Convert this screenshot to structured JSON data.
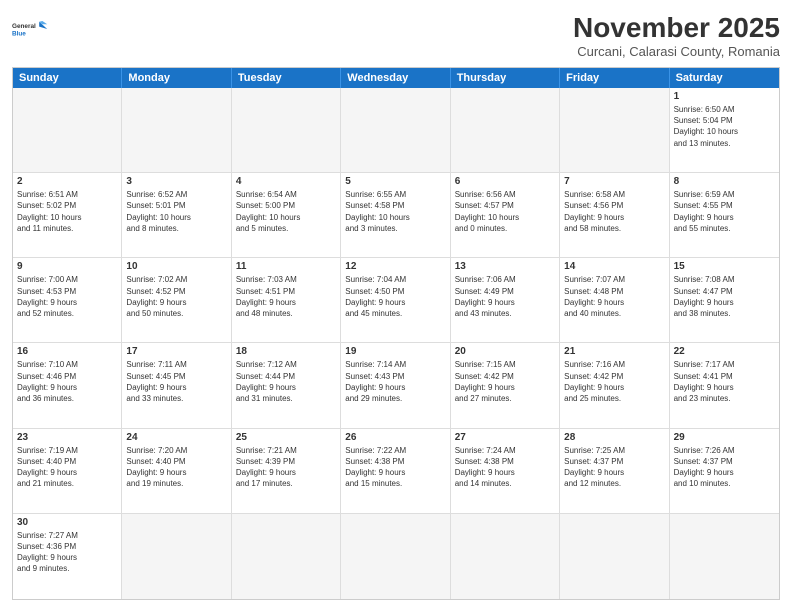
{
  "logo": {
    "text_general": "General",
    "text_blue": "Blue"
  },
  "title": {
    "month_year": "November 2025",
    "location": "Curcani, Calarasi County, Romania"
  },
  "header_days": [
    "Sunday",
    "Monday",
    "Tuesday",
    "Wednesday",
    "Thursday",
    "Friday",
    "Saturday"
  ],
  "weeks": [
    [
      {
        "day": "",
        "info": ""
      },
      {
        "day": "",
        "info": ""
      },
      {
        "day": "",
        "info": ""
      },
      {
        "day": "",
        "info": ""
      },
      {
        "day": "",
        "info": ""
      },
      {
        "day": "",
        "info": ""
      },
      {
        "day": "1",
        "info": "Sunrise: 6:50 AM\nSunset: 5:04 PM\nDaylight: 10 hours\nand 13 minutes."
      }
    ],
    [
      {
        "day": "2",
        "info": "Sunrise: 6:51 AM\nSunset: 5:02 PM\nDaylight: 10 hours\nand 11 minutes."
      },
      {
        "day": "3",
        "info": "Sunrise: 6:52 AM\nSunset: 5:01 PM\nDaylight: 10 hours\nand 8 minutes."
      },
      {
        "day": "4",
        "info": "Sunrise: 6:54 AM\nSunset: 5:00 PM\nDaylight: 10 hours\nand 5 minutes."
      },
      {
        "day": "5",
        "info": "Sunrise: 6:55 AM\nSunset: 4:58 PM\nDaylight: 10 hours\nand 3 minutes."
      },
      {
        "day": "6",
        "info": "Sunrise: 6:56 AM\nSunset: 4:57 PM\nDaylight: 10 hours\nand 0 minutes."
      },
      {
        "day": "7",
        "info": "Sunrise: 6:58 AM\nSunset: 4:56 PM\nDaylight: 9 hours\nand 58 minutes."
      },
      {
        "day": "8",
        "info": "Sunrise: 6:59 AM\nSunset: 4:55 PM\nDaylight: 9 hours\nand 55 minutes."
      }
    ],
    [
      {
        "day": "9",
        "info": "Sunrise: 7:00 AM\nSunset: 4:53 PM\nDaylight: 9 hours\nand 52 minutes."
      },
      {
        "day": "10",
        "info": "Sunrise: 7:02 AM\nSunset: 4:52 PM\nDaylight: 9 hours\nand 50 minutes."
      },
      {
        "day": "11",
        "info": "Sunrise: 7:03 AM\nSunset: 4:51 PM\nDaylight: 9 hours\nand 48 minutes."
      },
      {
        "day": "12",
        "info": "Sunrise: 7:04 AM\nSunset: 4:50 PM\nDaylight: 9 hours\nand 45 minutes."
      },
      {
        "day": "13",
        "info": "Sunrise: 7:06 AM\nSunset: 4:49 PM\nDaylight: 9 hours\nand 43 minutes."
      },
      {
        "day": "14",
        "info": "Sunrise: 7:07 AM\nSunset: 4:48 PM\nDaylight: 9 hours\nand 40 minutes."
      },
      {
        "day": "15",
        "info": "Sunrise: 7:08 AM\nSunset: 4:47 PM\nDaylight: 9 hours\nand 38 minutes."
      }
    ],
    [
      {
        "day": "16",
        "info": "Sunrise: 7:10 AM\nSunset: 4:46 PM\nDaylight: 9 hours\nand 36 minutes."
      },
      {
        "day": "17",
        "info": "Sunrise: 7:11 AM\nSunset: 4:45 PM\nDaylight: 9 hours\nand 33 minutes."
      },
      {
        "day": "18",
        "info": "Sunrise: 7:12 AM\nSunset: 4:44 PM\nDaylight: 9 hours\nand 31 minutes."
      },
      {
        "day": "19",
        "info": "Sunrise: 7:14 AM\nSunset: 4:43 PM\nDaylight: 9 hours\nand 29 minutes."
      },
      {
        "day": "20",
        "info": "Sunrise: 7:15 AM\nSunset: 4:42 PM\nDaylight: 9 hours\nand 27 minutes."
      },
      {
        "day": "21",
        "info": "Sunrise: 7:16 AM\nSunset: 4:42 PM\nDaylight: 9 hours\nand 25 minutes."
      },
      {
        "day": "22",
        "info": "Sunrise: 7:17 AM\nSunset: 4:41 PM\nDaylight: 9 hours\nand 23 minutes."
      }
    ],
    [
      {
        "day": "23",
        "info": "Sunrise: 7:19 AM\nSunset: 4:40 PM\nDaylight: 9 hours\nand 21 minutes."
      },
      {
        "day": "24",
        "info": "Sunrise: 7:20 AM\nSunset: 4:40 PM\nDaylight: 9 hours\nand 19 minutes."
      },
      {
        "day": "25",
        "info": "Sunrise: 7:21 AM\nSunset: 4:39 PM\nDaylight: 9 hours\nand 17 minutes."
      },
      {
        "day": "26",
        "info": "Sunrise: 7:22 AM\nSunset: 4:38 PM\nDaylight: 9 hours\nand 15 minutes."
      },
      {
        "day": "27",
        "info": "Sunrise: 7:24 AM\nSunset: 4:38 PM\nDaylight: 9 hours\nand 14 minutes."
      },
      {
        "day": "28",
        "info": "Sunrise: 7:25 AM\nSunset: 4:37 PM\nDaylight: 9 hours\nand 12 minutes."
      },
      {
        "day": "29",
        "info": "Sunrise: 7:26 AM\nSunset: 4:37 PM\nDaylight: 9 hours\nand 10 minutes."
      }
    ],
    [
      {
        "day": "30",
        "info": "Sunrise: 7:27 AM\nSunset: 4:36 PM\nDaylight: 9 hours\nand 9 minutes."
      },
      {
        "day": "",
        "info": ""
      },
      {
        "day": "",
        "info": ""
      },
      {
        "day": "",
        "info": ""
      },
      {
        "day": "",
        "info": ""
      },
      {
        "day": "",
        "info": ""
      },
      {
        "day": "",
        "info": ""
      }
    ]
  ]
}
